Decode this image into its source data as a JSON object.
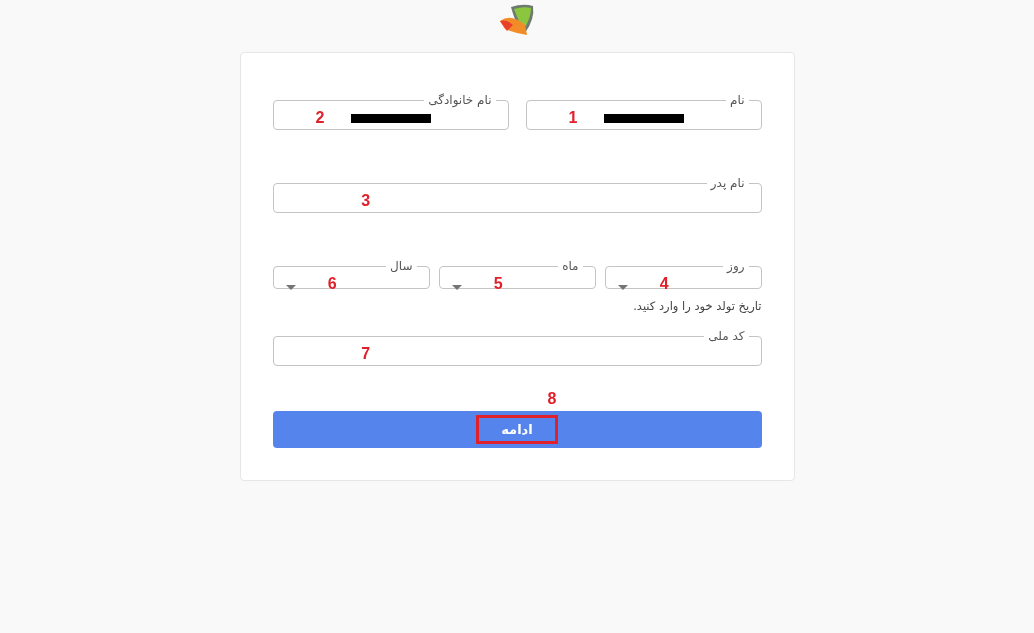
{
  "name_row": [
    {
      "label": "نام",
      "redacted": true,
      "marker": "1"
    },
    {
      "label": "نام خانوادگی",
      "redacted": true,
      "marker": "2"
    }
  ],
  "father": {
    "label": "نام پدر",
    "marker": "3"
  },
  "birth_date": {
    "selects": [
      {
        "label": "روز",
        "marker": "4"
      },
      {
        "label": "ماه",
        "marker": "5"
      },
      {
        "label": "سال",
        "marker": "6"
      }
    ],
    "hint": "تاریخ تولد خود را وارد کنید."
  },
  "national_code": {
    "label": "کد ملی",
    "marker": "7"
  },
  "button": {
    "label": "ادامه",
    "marker": "8",
    "highlighted": true
  }
}
